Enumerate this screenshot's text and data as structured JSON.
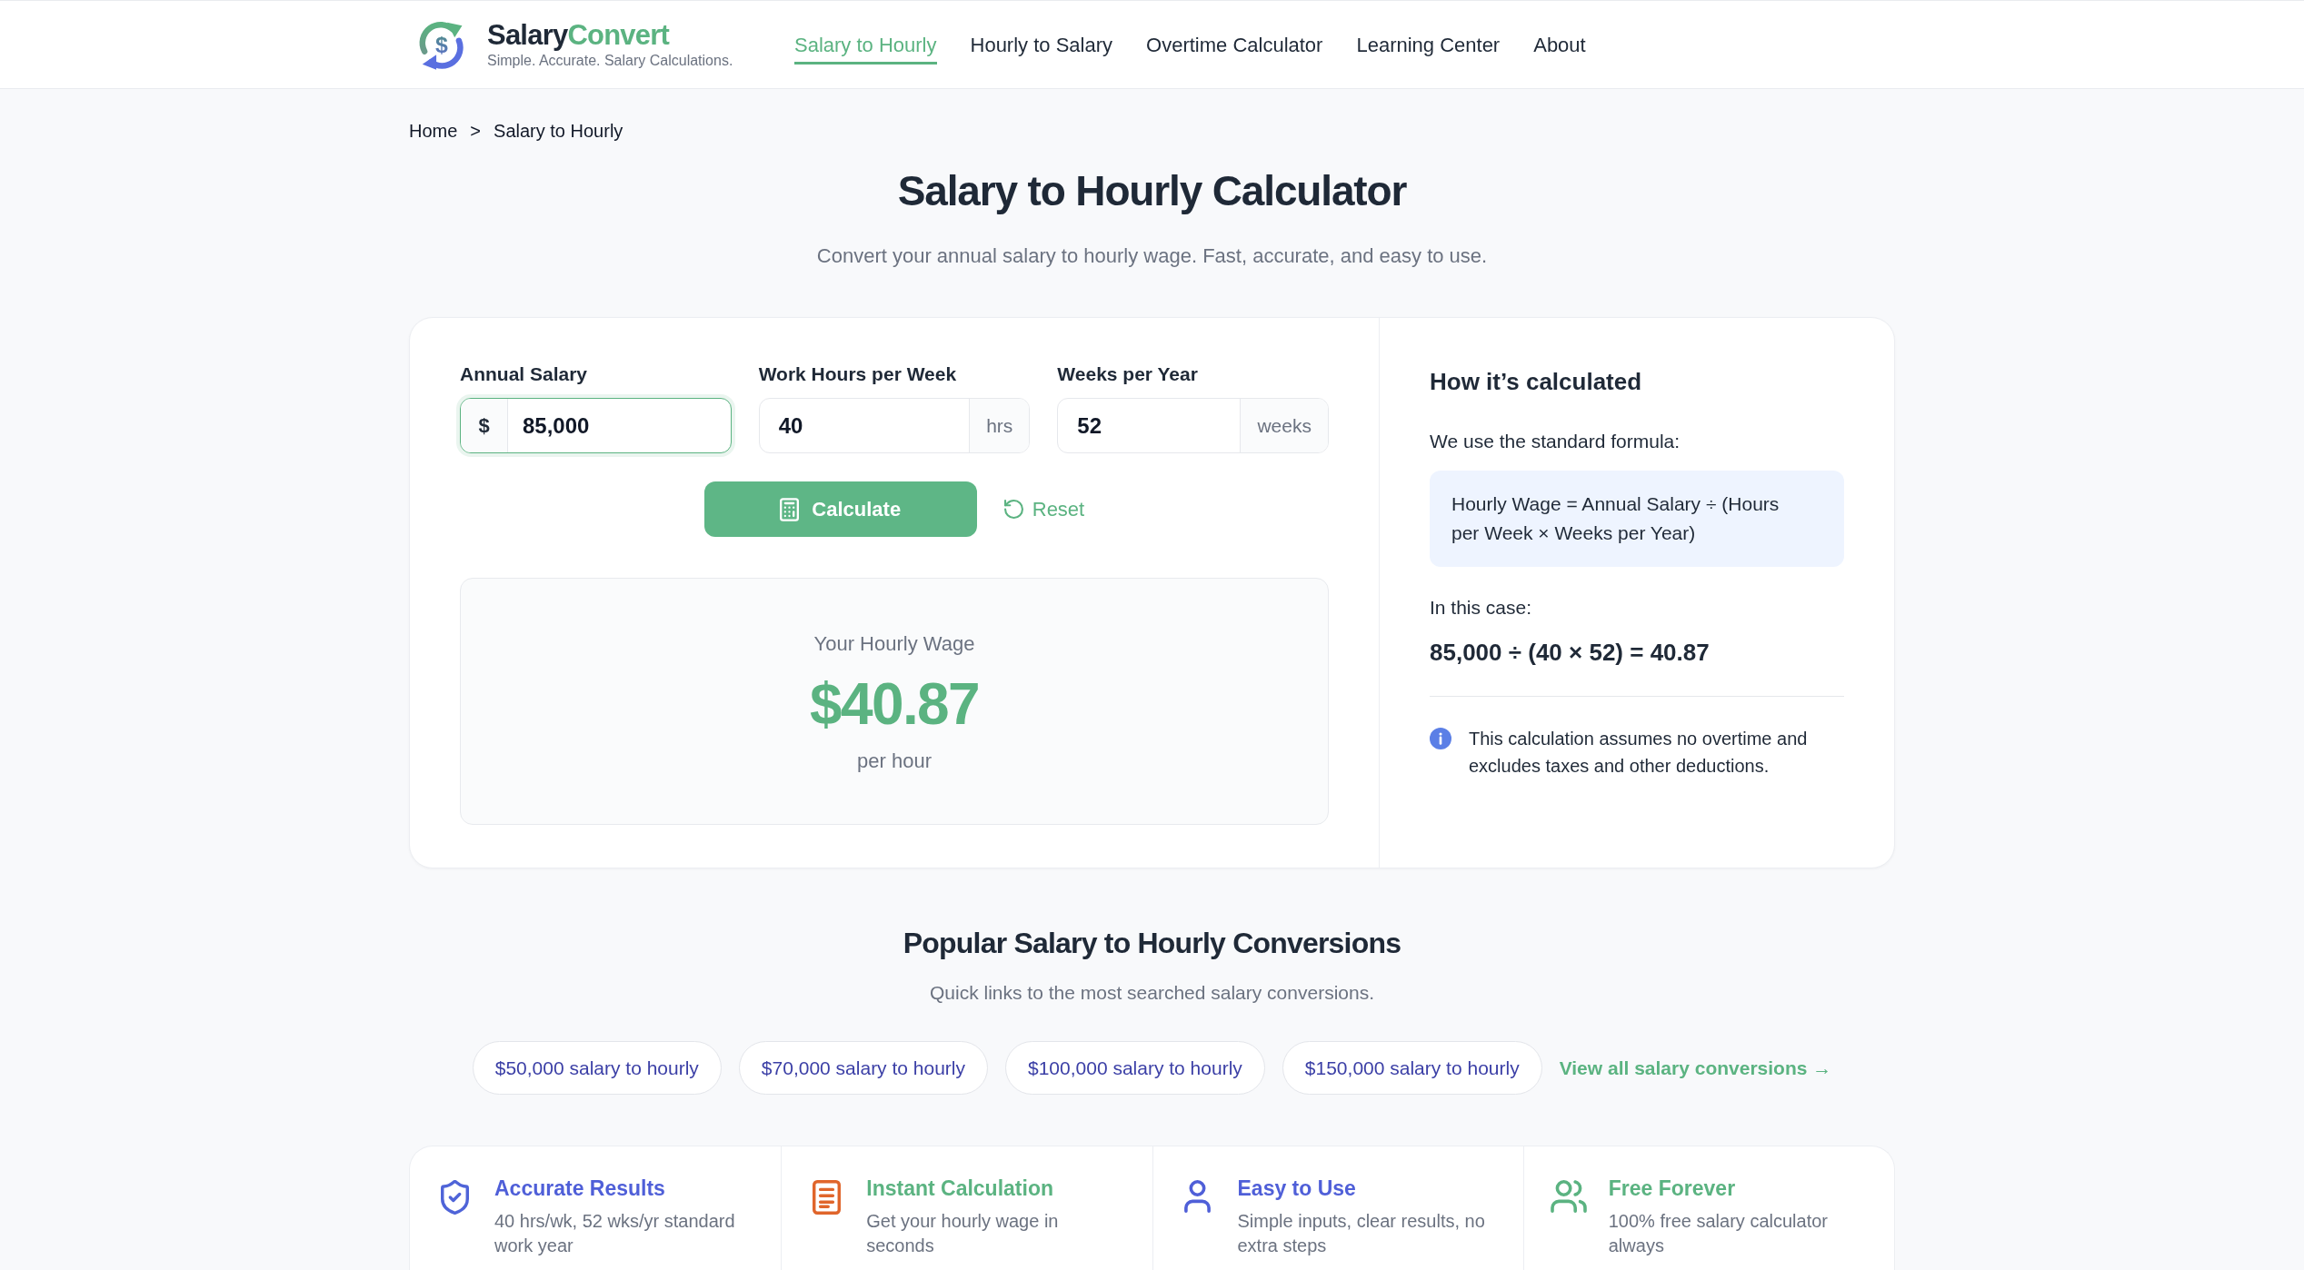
{
  "header": {
    "brand": {
      "logo_glyph": "$",
      "name": "Salary",
      "name_accent": "Convert",
      "tagline": "Simple. Accurate. Salary Calculations."
    },
    "nav": [
      {
        "label": "Salary to Hourly",
        "selected": true
      },
      {
        "label": "Hourly to Salary",
        "selected": false
      },
      {
        "label": "Overtime Calculator",
        "selected": false
      },
      {
        "label": "Learning Center",
        "selected": false
      },
      {
        "label": "About",
        "selected": false
      }
    ]
  },
  "breadcrumb": {
    "items": [
      "Home",
      "Salary to Hourly"
    ],
    "separator": ">"
  },
  "page": {
    "title": "Salary to Hourly Calculator",
    "subtitle": "Convert your annual salary to hourly wage. Fast, accurate, and easy to use."
  },
  "calculator": {
    "fields": [
      {
        "label": "Annual Salary",
        "prefix": "$",
        "value": "85,000",
        "focused": true
      },
      {
        "label": "Work Hours per Week",
        "value": "40",
        "suffix": "hrs",
        "focused": false
      },
      {
        "label": "Weeks per Year",
        "value": "52",
        "suffix": "weeks",
        "focused": false
      }
    ],
    "calculate_button": "Calculate",
    "reset_button": "Reset",
    "result": {
      "label": "Your Hourly Wage",
      "value": "$40.87",
      "unit": "per hour"
    }
  },
  "explanation": {
    "title": "How it’s calculated",
    "intro": "We use the standard formula:",
    "formula": "Hourly Wage = Annual Salary ÷ (Hours per Week × Weeks per Year)",
    "case_label": "In this case:",
    "case_formula": "85,000 ÷ (40 × 52) = 40.87",
    "note": "This calculation assumes no overtime and excludes taxes and other deductions."
  },
  "popular": {
    "title": "Popular Salary to Hourly Conversions",
    "subtitle": "Quick links to the most searched salary conversions.",
    "links": [
      "$50,000 salary to hourly",
      "$70,000 salary to hourly",
      "$100,000 salary to hourly",
      "$150,000 salary to hourly"
    ],
    "view_all": "View all salary conversions →"
  },
  "features": [
    {
      "icon": {
        "color": "#4f64d8"
      },
      "title": "Accurate Results",
      "color": "#4f5fd8",
      "description": "40 hrs/wk, 52 wks/yr standard work year"
    },
    {
      "icon": {
        "color": "#e0652b"
      },
      "title": "Instant Calculation",
      "color": "#5bb381",
      "description": "Get your hourly wage in seconds"
    },
    {
      "icon": {
        "color": "#4f5fd8"
      },
      "title": "Easy to Use",
      "color": "#4f5fd8",
      "description": "Simple inputs, clear results, no extra steps"
    },
    {
      "icon": {
        "color": "#5bb381"
      },
      "title": "Free Forever",
      "color": "#5bb381",
      "description": "100% free salary calculator always"
    }
  ]
}
